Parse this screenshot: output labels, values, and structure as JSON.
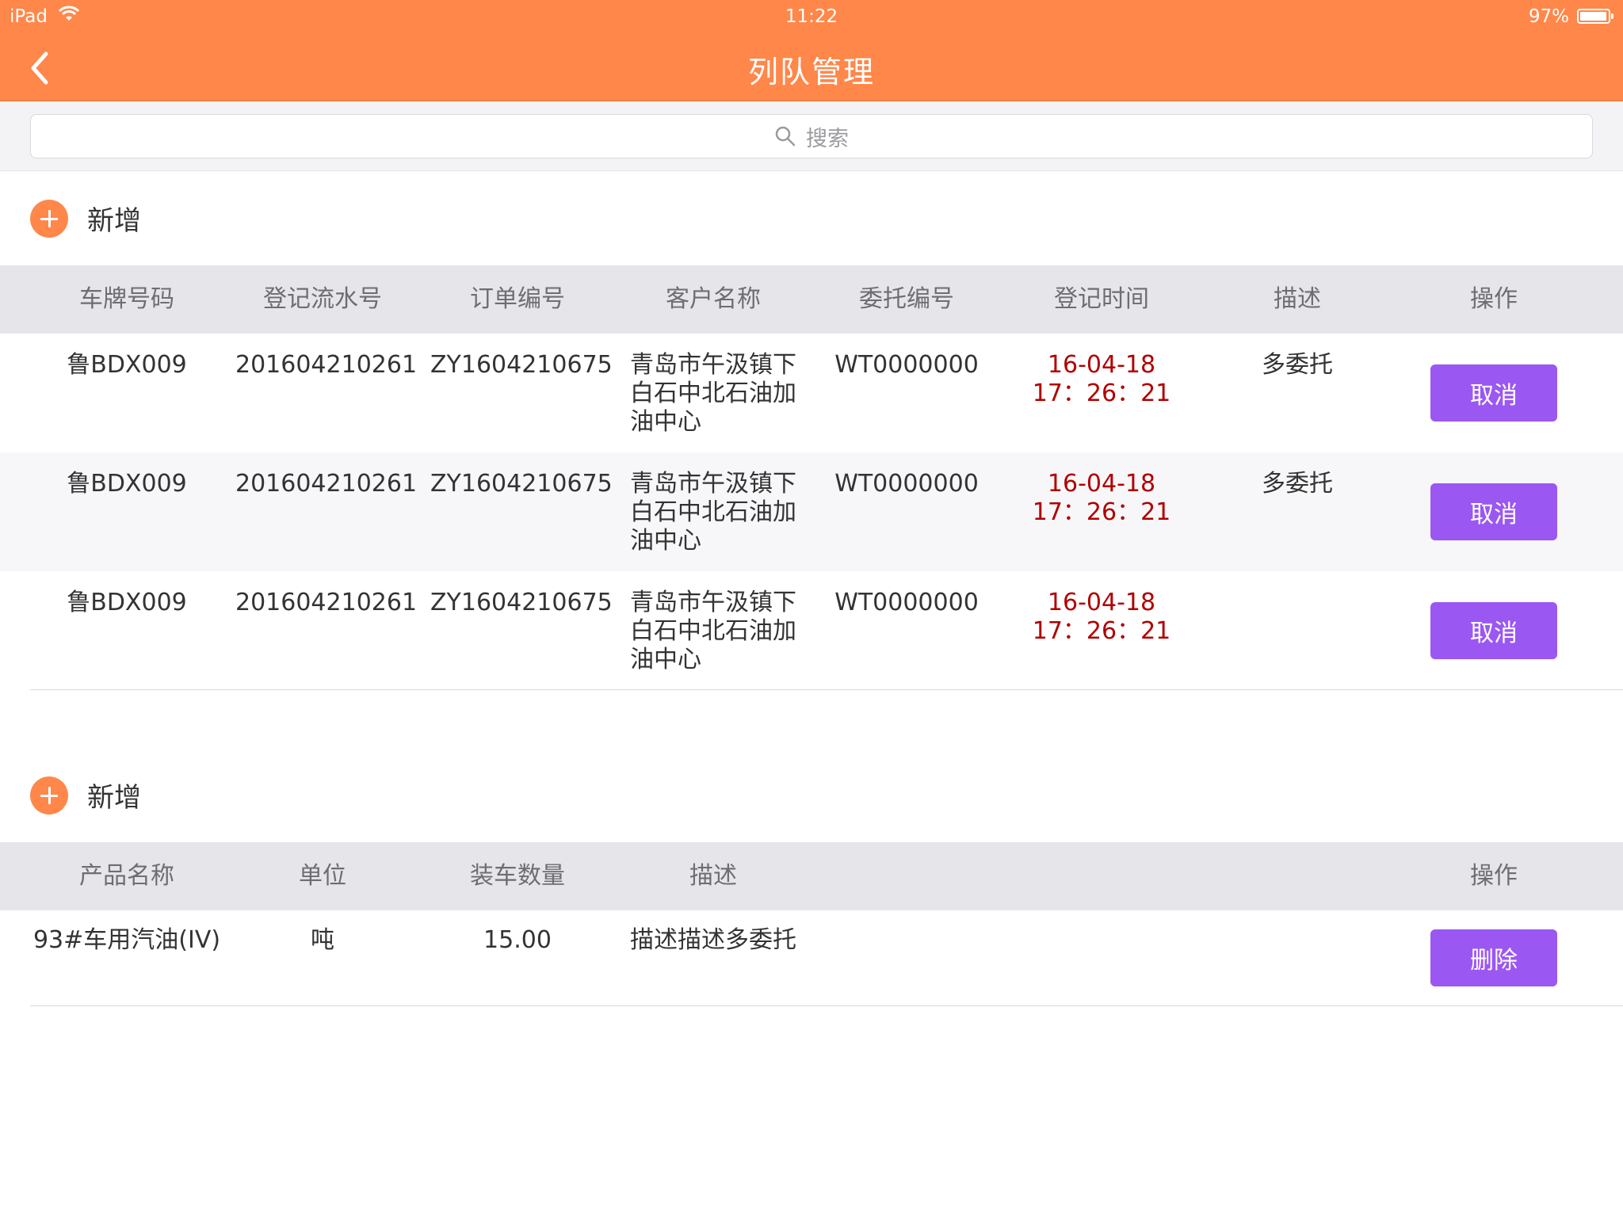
{
  "status_bar": {
    "device": "iPad",
    "time": "11:22",
    "battery": "97%"
  },
  "header": {
    "title": "列队管理",
    "back_icon": "chevron-left-icon"
  },
  "search": {
    "placeholder": "搜索",
    "icon": "search-icon"
  },
  "colors": {
    "accent": "#ff874a",
    "button": "#9b57f2",
    "time_text": "#b00000"
  },
  "queue_section": {
    "add_label": "新增",
    "columns": [
      "车牌号码",
      "登记流水号",
      "订单编号",
      "客户名称",
      "委托编号",
      "登记时间",
      "描述",
      "操作"
    ],
    "rows": [
      {
        "plate": "鲁BDX009",
        "serial": "201604210261",
        "order": "ZY1604210675",
        "customer": [
          "青岛市午汲镇下",
          "白石中北石油加",
          "油中心"
        ],
        "entrust": "WT0000000",
        "date": "16-04-18",
        "time": "17：26：21",
        "desc": "多委托",
        "action": "取消"
      },
      {
        "plate": "鲁BDX009",
        "serial": "201604210261",
        "order": "ZY1604210675",
        "customer": [
          "青岛市午汲镇下",
          "白石中北石油加",
          "油中心"
        ],
        "entrust": "WT0000000",
        "date": "16-04-18",
        "time": "17：26：21",
        "desc": "多委托",
        "action": "取消"
      },
      {
        "plate": "鲁BDX009",
        "serial": "201604210261",
        "order": "ZY1604210675",
        "customer": [
          "青岛市午汲镇下",
          "白石中北石油加",
          "油中心"
        ],
        "entrust": "WT0000000",
        "date": "16-04-18",
        "time": "17：26：21",
        "desc": "",
        "action": "取消"
      }
    ]
  },
  "product_section": {
    "add_label": "新增",
    "columns": [
      "产品名称",
      "单位",
      "装车数量",
      "描述",
      "操作"
    ],
    "rows": [
      {
        "name": "93#车用汽油(IV)",
        "unit": "吨",
        "quantity": "15.00",
        "desc": "描述描述多委托",
        "action": "删除"
      }
    ]
  }
}
